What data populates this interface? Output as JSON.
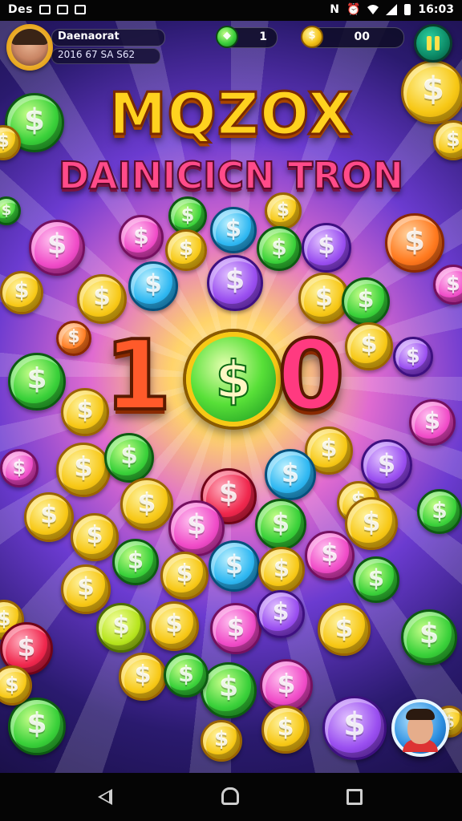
{
  "status_bar": {
    "left_text": "Des",
    "time": "16:03"
  },
  "player": {
    "name": "Daenaorat",
    "stats": "2016 67 SA S62"
  },
  "currency": {
    "gem_count": "1",
    "coin_count": "00",
    "gem_icon": "gem-icon",
    "coin_icon": "coin-icon"
  },
  "title": {
    "line1": "MQZOX",
    "line2": "DAINICICN TRON"
  },
  "big_number": {
    "left": "1",
    "right": "0",
    "coin_symbol": "$"
  },
  "colors": {
    "title_gold": "#ffd21f",
    "pause_green": "#0c8a66"
  },
  "coins": [
    {
      "color": "gold",
      "s": "$"
    },
    {
      "color": "green",
      "s": "$"
    },
    {
      "color": "gold",
      "s": "$"
    },
    {
      "color": "green",
      "s": "$"
    },
    {
      "color": "gold",
      "s": "$"
    },
    {
      "color": "pink",
      "s": "$"
    },
    {
      "color": "green",
      "s": "$"
    },
    {
      "color": "pink",
      "s": "$"
    },
    {
      "color": "blue",
      "s": "$"
    },
    {
      "color": "gold",
      "s": "$"
    },
    {
      "color": "purple",
      "s": "$"
    },
    {
      "color": "orange",
      "s": "$"
    },
    {
      "color": "gold",
      "s": "$"
    },
    {
      "color": "green",
      "s": "$"
    },
    {
      "color": "gold",
      "s": "$"
    },
    {
      "color": "blue",
      "s": "$"
    },
    {
      "color": "purple",
      "s": "$"
    },
    {
      "color": "gold",
      "s": "$"
    },
    {
      "color": "green",
      "s": "$"
    },
    {
      "color": "pink",
      "s": "$"
    },
    {
      "color": "gold",
      "s": "$"
    },
    {
      "color": "orange",
      "s": "$"
    },
    {
      "color": "gold",
      "s": "$"
    },
    {
      "color": "green",
      "s": "$"
    },
    {
      "color": "purple",
      "s": "$"
    },
    {
      "color": "gold",
      "s": "$"
    },
    {
      "color": "pink",
      "s": "$"
    },
    {
      "color": "gold",
      "s": "$"
    },
    {
      "color": "green",
      "s": "$"
    },
    {
      "color": "gold",
      "s": "$"
    },
    {
      "color": "purple",
      "s": "$"
    },
    {
      "color": "pink",
      "s": "$"
    },
    {
      "color": "gold",
      "s": "$"
    },
    {
      "color": "red",
      "s": "$"
    },
    {
      "color": "blue",
      "s": "$"
    },
    {
      "color": "gold",
      "s": "$"
    },
    {
      "color": "gold",
      "s": "$"
    },
    {
      "color": "pink",
      "s": "$"
    },
    {
      "color": "green",
      "s": "$"
    },
    {
      "color": "gold",
      "s": "$"
    },
    {
      "color": "green",
      "s": "$"
    },
    {
      "color": "gold",
      "s": "$"
    },
    {
      "color": "green",
      "s": "$"
    },
    {
      "color": "gold",
      "s": "$"
    },
    {
      "color": "blue",
      "s": "$"
    },
    {
      "color": "gold",
      "s": "$"
    },
    {
      "color": "pink",
      "s": "$"
    },
    {
      "color": "green",
      "s": "$"
    },
    {
      "color": "gold",
      "s": "$"
    },
    {
      "color": "lime",
      "s": "$"
    },
    {
      "color": "gold",
      "s": "$"
    },
    {
      "color": "pink",
      "s": "$"
    },
    {
      "color": "purple",
      "s": "$"
    },
    {
      "color": "gold",
      "s": "$"
    },
    {
      "color": "green",
      "s": "$"
    },
    {
      "color": "gold",
      "s": "$"
    },
    {
      "color": "red",
      "s": "$"
    },
    {
      "color": "gold",
      "s": "$"
    },
    {
      "color": "green",
      "s": "$"
    },
    {
      "color": "pink",
      "s": "$"
    }
  ]
}
